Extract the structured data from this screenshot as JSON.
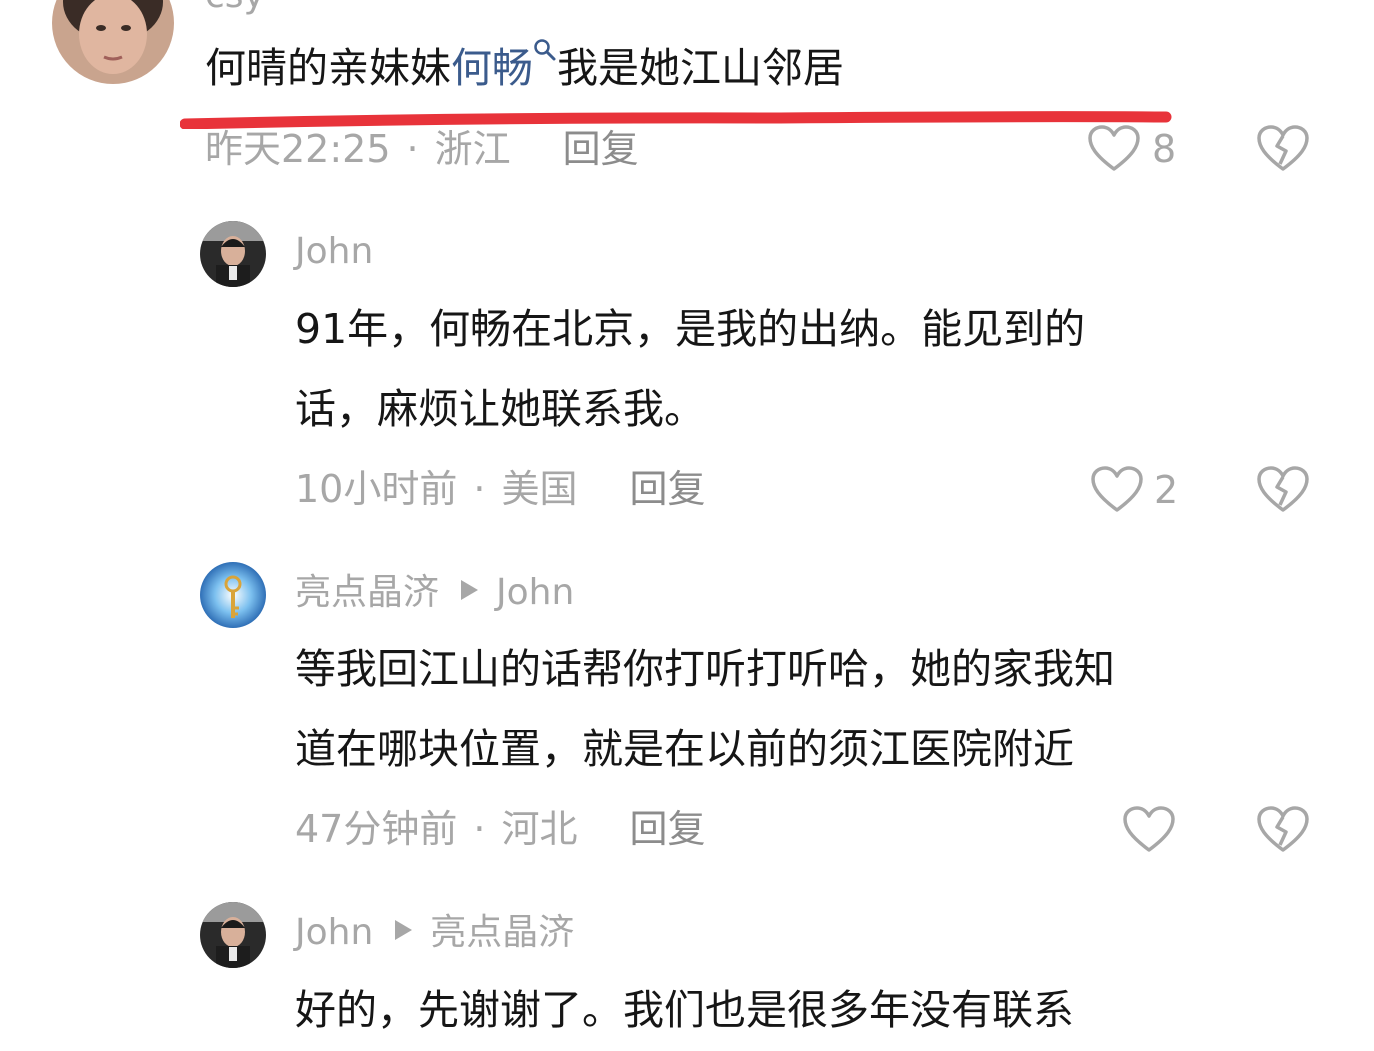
{
  "comments": [
    {
      "username": "csy",
      "text_before": "何晴的亲妹妹",
      "link_text": "何畅",
      "text_after": "我是她江山邻居",
      "time": "昨天22:25",
      "location": "浙江",
      "reply_label": "回复",
      "likes": "8"
    },
    {
      "username": "John",
      "line1": "91年，何畅在北京，是我的出纳。能见到的",
      "line2": "话，麻烦让她联系我。",
      "time": "10小时前",
      "location": "美国",
      "reply_label": "回复",
      "likes": "2"
    },
    {
      "username": "亮点晶济",
      "reply_to": "John",
      "line1": "等我回江山的话帮你打听打听哈，她的家我知",
      "line2": "道在哪块位置，就是在以前的须江医院附近",
      "time": "47分钟前",
      "location": "河北",
      "reply_label": "回复"
    },
    {
      "username": "John",
      "reply_to": "亮点晶济",
      "line1": "好的，先谢谢了。我们也是很多年没有联系"
    }
  ],
  "separator": "·",
  "icons": {
    "search": "search-icon",
    "like": "heart-outline-icon",
    "dislike": "broken-heart-icon",
    "reply_to": "play-triangle-icon"
  },
  "colors": {
    "text": "#161616",
    "muted": "#a7a7a7",
    "link": "#3b5b8c",
    "highlight": "#e8333a"
  }
}
